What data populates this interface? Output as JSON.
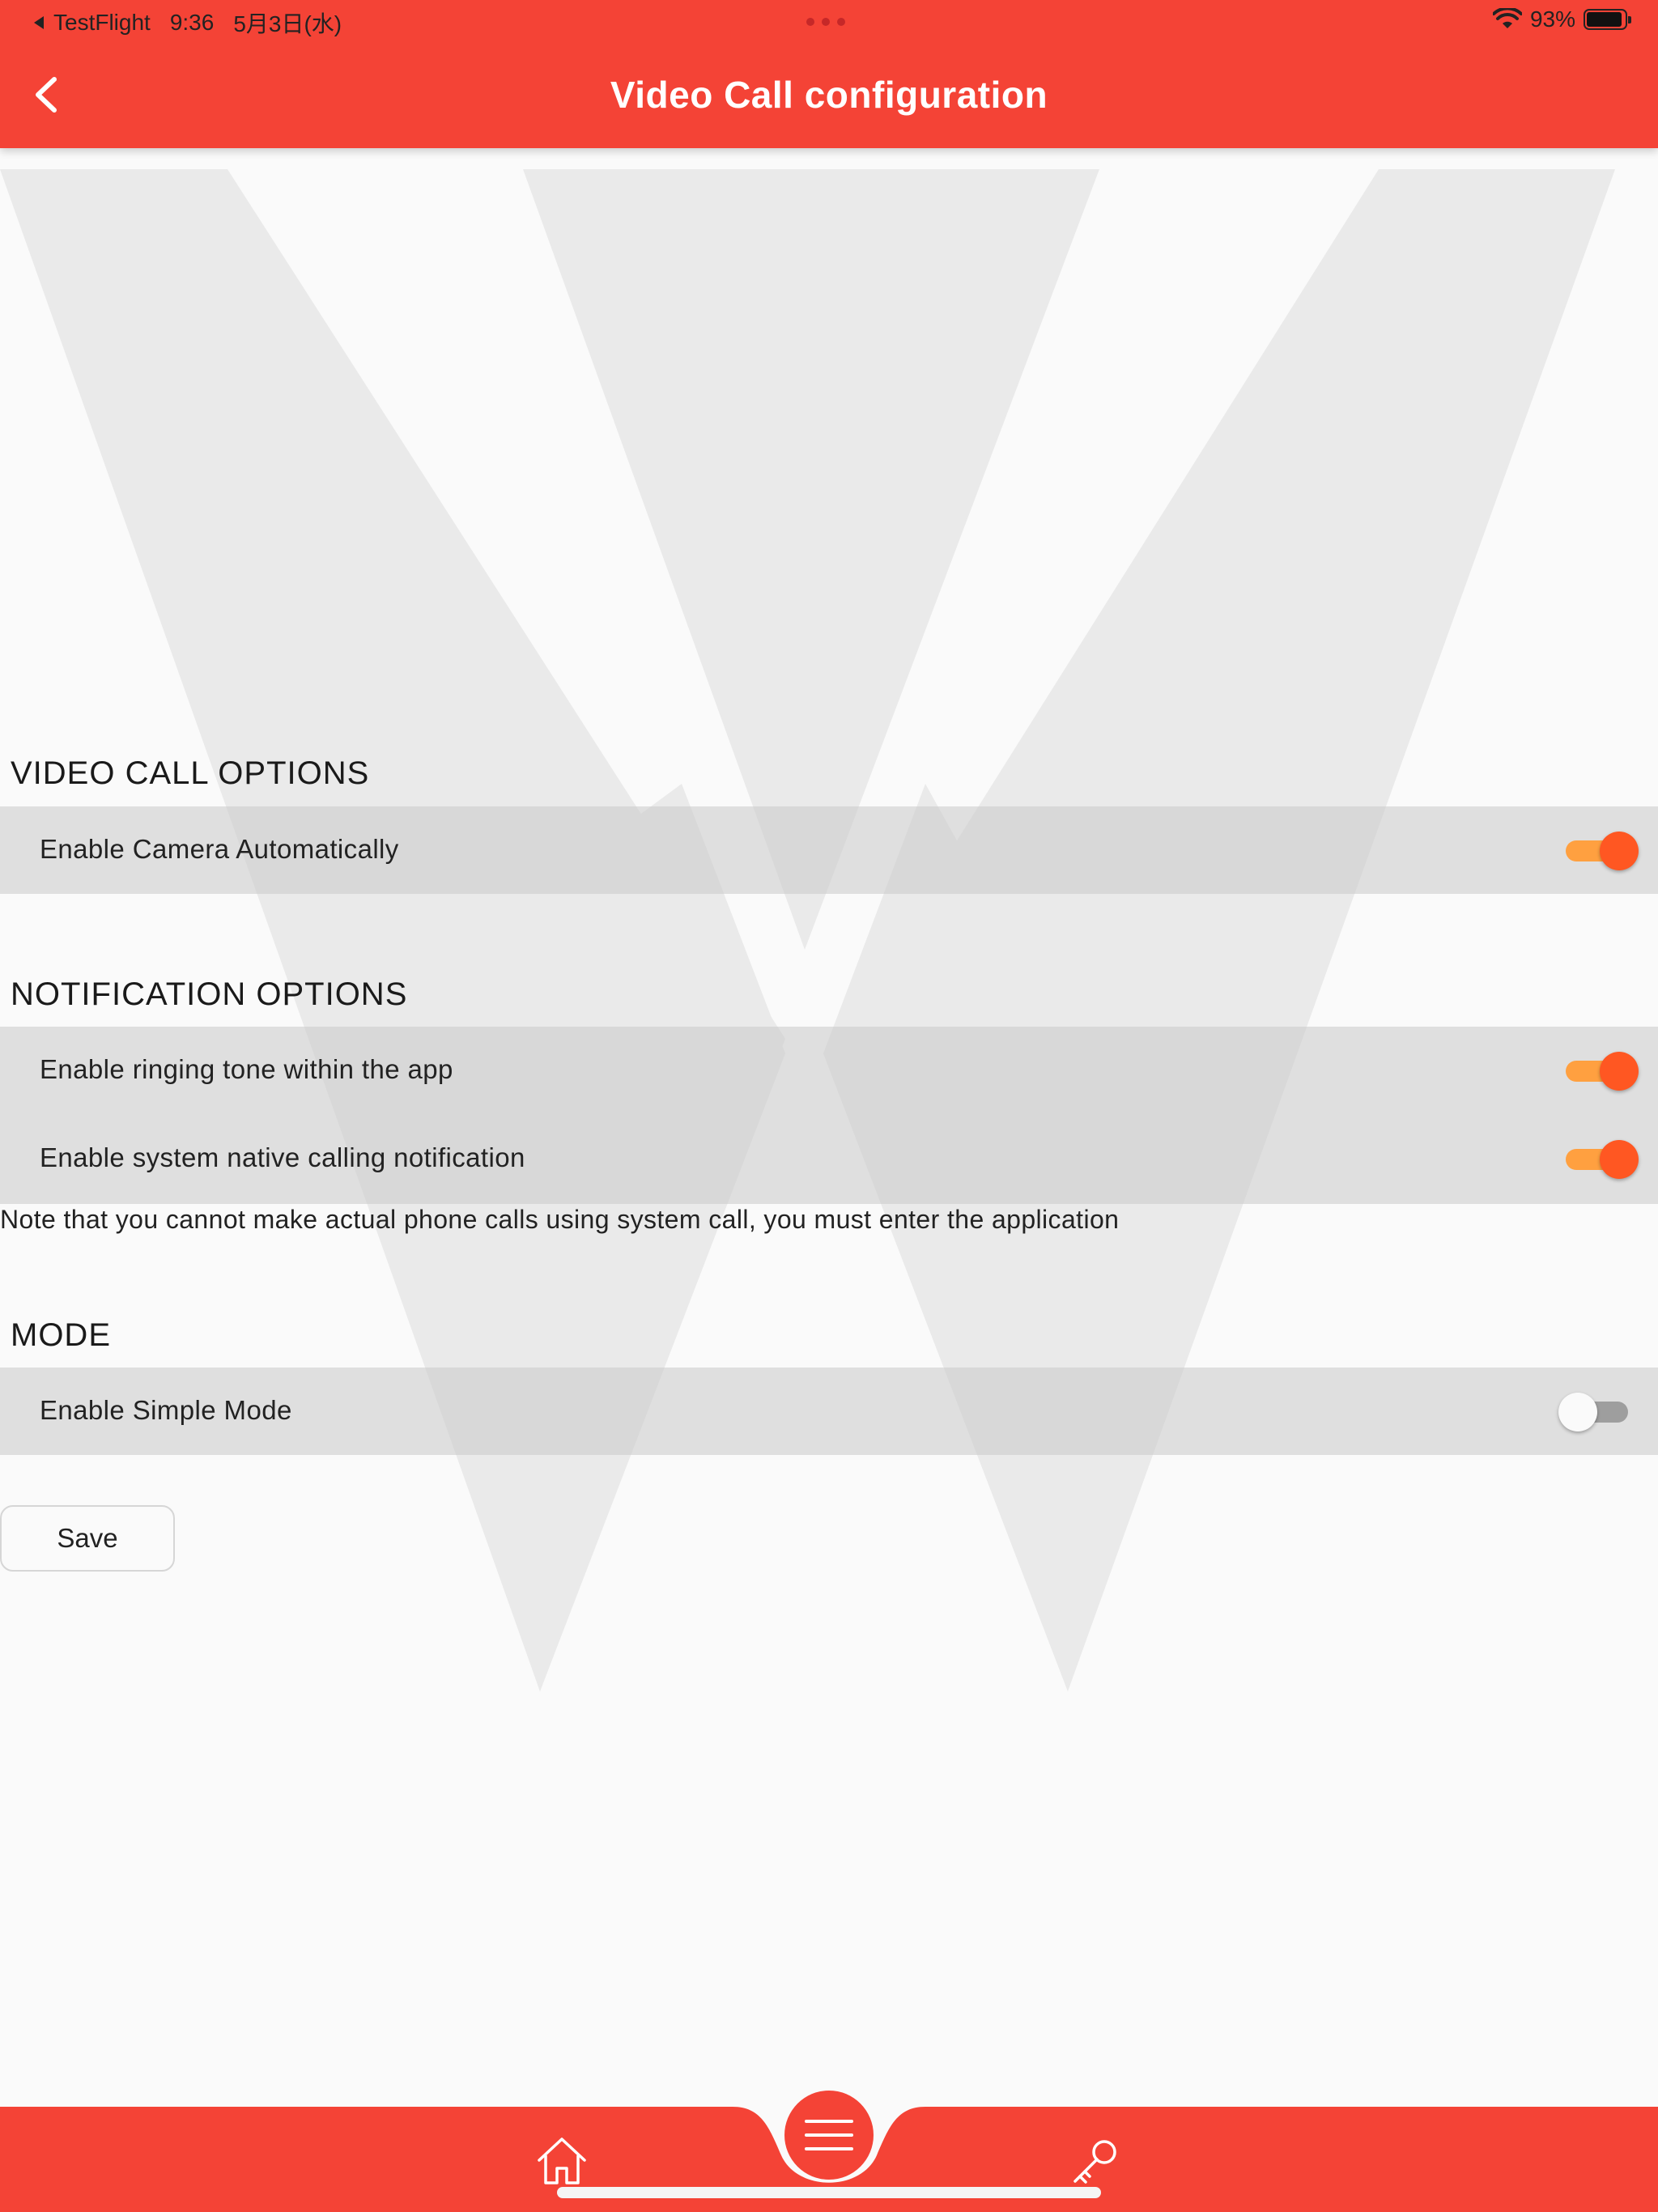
{
  "status_bar": {
    "back_app": "TestFlight",
    "time": "9:36",
    "date": "5月3日(水)",
    "battery_percent": "93%",
    "battery_level": 0.93
  },
  "header": {
    "title": "Video Call configuration",
    "back_icon": "chevron-left-icon"
  },
  "colors": {
    "primary": "#f44336",
    "toggle_on_thumb": "#ff5722",
    "toggle_on_track": "#ffa040",
    "toggle_off_track": "#9e9e9e",
    "row_background": "#dcdcdc",
    "page_background": "#fafafa"
  },
  "sections": {
    "video_call": {
      "heading": "VIDEO CALL OPTIONS",
      "options": [
        {
          "label": "Enable Camera Automatically",
          "enabled": true
        }
      ]
    },
    "notification": {
      "heading": "NOTIFICATION OPTIONS",
      "options": [
        {
          "label": "Enable ringing tone within the app",
          "enabled": true
        },
        {
          "label": "Enable system native calling notification",
          "enabled": true
        }
      ],
      "note": "Note that you cannot make actual phone calls using system call, you must enter the application"
    },
    "mode": {
      "heading": "MODE",
      "options": [
        {
          "label": "Enable Simple Mode",
          "enabled": false
        }
      ]
    }
  },
  "save_button": {
    "label": "Save"
  },
  "bottom_nav": {
    "items": [
      {
        "icon": "home-icon"
      },
      {
        "icon": "menu-icon"
      },
      {
        "icon": "key-icon"
      }
    ]
  }
}
